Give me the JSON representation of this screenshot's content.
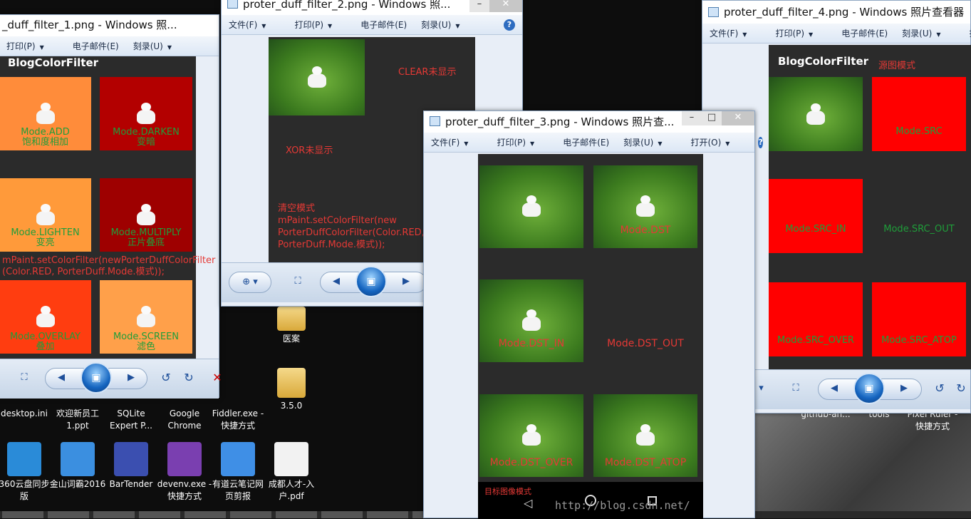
{
  "desktop": {
    "icons_row1": [
      {
        "label": "desktop.ini"
      },
      {
        "label": "欢迎新员工1.ppt"
      },
      {
        "label": "SQLite Expert P..."
      },
      {
        "label": "Google Chrome"
      },
      {
        "label": "Fiddler.exe - 快捷方式"
      },
      {
        "label": "3.5.0"
      }
    ],
    "icons_row2": [
      {
        "label": "360云盘同步版"
      },
      {
        "label": "金山词霸2016"
      },
      {
        "label": "BarTender"
      },
      {
        "label": "devenv.exe - 快捷方式"
      },
      {
        "label": "有道云笔记网页剪报"
      },
      {
        "label": "成都人才-入户.pdf"
      }
    ],
    "folder_label": "医案",
    "right_icons": [
      {
        "label": "github-an..."
      },
      {
        "label": "tools"
      },
      {
        "label": "Pixel Ruler - 快捷方式"
      }
    ]
  },
  "menus": {
    "file": "文件(F)",
    "print": "打印(P)",
    "email": "电子邮件(E)",
    "burn": "刻录(U)",
    "open": "打开(O)"
  },
  "win1": {
    "title": "_duff_filter_1.png - Windows 照...",
    "app_title": "BlogColorFilter",
    "tiles": [
      {
        "l1": "Mode.ADD",
        "l2": "饱和度相加"
      },
      {
        "l1": "Mode.DARKEN",
        "l2": "变暗"
      },
      {
        "l1": "Mode.LIGHTEN",
        "l2": "变亮"
      },
      {
        "l1": "Mode.MULTIPLY",
        "l2": "正片叠底"
      },
      {
        "l1": "Mode.OVERLAY",
        "l2": "叠加"
      },
      {
        "l1": "Mode.SCREEN",
        "l2": "滤色"
      }
    ],
    "code_line1": "mPaint.setColorFilter(newPorterDuffColorFilter",
    "code_line2": "(Color.RED, PorterDuff.Mode.模式));"
  },
  "win2": {
    "title": "proter_duff_filter_2.png - Windows 照...",
    "clear_note": "CLEAR未显示",
    "xor_note": "XOR未显示",
    "clear_mode_title": "清空模式",
    "code1": "mPaint.setColorFilter(new",
    "code2": "PorterDuffColorFilter(Color.RED,",
    "code3": "PorterDuff.Mode.模式));"
  },
  "win3": {
    "title": "proter_duff_filter_3.png - Windows 照片查...",
    "tiles": [
      {
        "label": ""
      },
      {
        "label": "Mode.DST"
      },
      {
        "label": "Mode.DST_IN"
      },
      {
        "label": "Mode.DST_OUT"
      },
      {
        "label": "Mode.DST_OVER"
      },
      {
        "label": "Mode.DST_ATOP"
      }
    ],
    "footer_note": "目标图像模式",
    "watermark": "http://blog.csdn.net/"
  },
  "win4": {
    "title": "proter_duff_filter_4.png - Windows 照片查看器",
    "app_title": "BlogColorFilter",
    "src_note": "源图模式",
    "tiles": [
      {
        "label": ""
      },
      {
        "label": "Mode.SRC"
      },
      {
        "label": "Mode.SRC_IN"
      },
      {
        "label": "Mode.SRC_OUT"
      },
      {
        "label": "Mode.SRC_OVER"
      },
      {
        "label": "Mode.SRC_ATOP"
      }
    ]
  }
}
